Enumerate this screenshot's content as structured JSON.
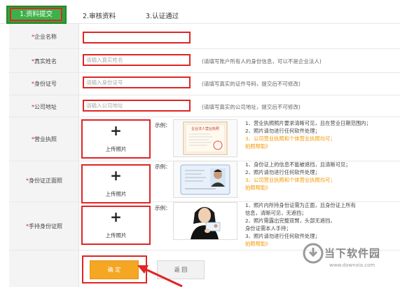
{
  "tabs": [
    {
      "label": "1.资料提交",
      "active": true
    },
    {
      "label": "2.审核资料",
      "active": false
    },
    {
      "label": "3.认证通过",
      "active": false
    }
  ],
  "form": {
    "required_mark": "*",
    "company_name": {
      "label": "企业名称",
      "value": "",
      "placeholder": ""
    },
    "real_name": {
      "label": "真实姓名",
      "placeholder": "请输入真实姓名",
      "hint": "(请填写账户所有人的身份信息，可以不是企业法人)"
    },
    "id_number": {
      "label": "身份证号",
      "placeholder": "请输入身份证号",
      "hint": "(请填写真实的证件号码，提交后不可修改)"
    },
    "company_address": {
      "label": "公司地址",
      "placeholder": "请输入公司地址",
      "hint": "(请填写真实的公司地址，提交后不可修改)"
    }
  },
  "uploads": {
    "example_label": "示例：",
    "upload_label": "上传照片",
    "plus": "+",
    "license": {
      "label": "营业执照",
      "example_caption": "企业法人营业执照",
      "notes": [
        "1、营业执照照片要求清晰可见，且在营业日期范围内；",
        "2、照片请勿进行任何软件处理；",
        "3、公司营业执照和个体营业执照均可；",
        "拍照帮助》"
      ]
    },
    "id_front": {
      "label": "身份证正面照",
      "notes": [
        "1、身份证上的信息不能被遮挡，且清晰可见；",
        "2、照片请勿进行任何软件处理；",
        "3、公司营业执照和个体营业执照均可；",
        "拍照帮助》"
      ]
    },
    "id_hand": {
      "label": "手持身份证照",
      "notes": [
        "1、照片内所持身份证需为正面，且身份证上所有",
        "信息，清晰可见，无遮挡；",
        "2、照片需露出完整双臂，头部无遮挡，",
        "身份证需本人手持；",
        "3、照片请勿进行任何软件处理；",
        "拍照帮助》"
      ]
    }
  },
  "buttons": {
    "confirm": "确 定",
    "back": "返 回"
  },
  "watermark": {
    "brand": "当下软件园",
    "url": "www.downxia.com"
  },
  "colors": {
    "tab_green": "#3bb14a",
    "highlight_red": "#e02525",
    "confirm_orange": "#f5a623",
    "note_orange": "#f39800"
  }
}
